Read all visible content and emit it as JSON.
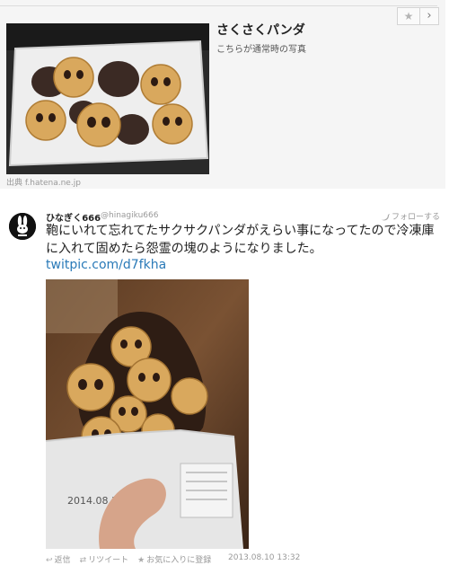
{
  "card": {
    "title": "さくさくパンダ",
    "subtitle": "こちらが通常時の写真",
    "source": "出典 f.hatena.ne.jp",
    "star_icon": "star-icon",
    "next_icon": "chevron-right-icon"
  },
  "tweet": {
    "display_name": "ひなぎく666",
    "handle": "@hinagiku666",
    "follow_label": "フォローする",
    "text": "鞄にいれて忘れてたサクサクパンダがえらい事になってたので冷凍庫に入れて固めたら怨霊の塊のようになりました。",
    "link": "twitpic.com/d7fkha",
    "actions": {
      "reply": "返信",
      "retweet": "リツイート",
      "favorite": "お気に入りに登録"
    },
    "date": "2013.08.10 13:32",
    "bag_date": "2014.08.3"
  }
}
